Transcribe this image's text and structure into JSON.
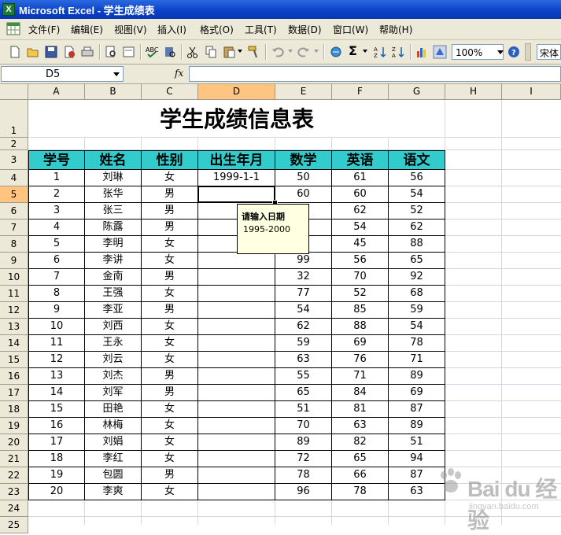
{
  "window": {
    "title": "Microsoft Excel - 学生成绩表",
    "app_icon_letter": "X"
  },
  "menu": [
    {
      "label": "文件(F)"
    },
    {
      "label": "编辑(E)"
    },
    {
      "label": "视图(V)"
    },
    {
      "label": "插入(I)"
    },
    {
      "label": "格式(O)"
    },
    {
      "label": "工具(T)"
    },
    {
      "label": "数据(D)"
    },
    {
      "label": "窗口(W)"
    },
    {
      "label": "帮助(H)"
    }
  ],
  "toolbar": {
    "zoom": "100%",
    "font": "宋体",
    "sigma": "Σ"
  },
  "formula_bar": {
    "name_box": "D5",
    "fx_label": "fx",
    "content": ""
  },
  "columns": [
    "A",
    "B",
    "C",
    "D",
    "E",
    "F",
    "G",
    "H",
    "I"
  ],
  "selected_column": "D",
  "rows": [
    "1",
    "2",
    "3",
    "4",
    "5",
    "6",
    "7",
    "8",
    "9",
    "10",
    "11",
    "12",
    "13",
    "14",
    "15",
    "16",
    "17",
    "18",
    "19",
    "20",
    "21",
    "22",
    "23",
    "24",
    "25"
  ],
  "selected_row": "5",
  "sheet": {
    "title": "学生成绩信息表",
    "headers": [
      "学号",
      "姓名",
      "性别",
      "出生年月",
      "数学",
      "英语",
      "语文"
    ],
    "records": [
      [
        "1",
        "刘琳",
        "女",
        "1999-1-1",
        "50",
        "61",
        "56"
      ],
      [
        "2",
        "张华",
        "男",
        "",
        "60",
        "60",
        "54"
      ],
      [
        "3",
        "张三",
        "男",
        "",
        "",
        "62",
        "52"
      ],
      [
        "4",
        "陈露",
        "男",
        "",
        "",
        "54",
        "62"
      ],
      [
        "5",
        "李明",
        "女",
        "",
        "",
        "45",
        "88"
      ],
      [
        "6",
        "李讲",
        "女",
        "",
        "99",
        "56",
        "65"
      ],
      [
        "7",
        "金南",
        "男",
        "",
        "32",
        "70",
        "92"
      ],
      [
        "8",
        "王强",
        "女",
        "",
        "77",
        "52",
        "68"
      ],
      [
        "9",
        "李亚",
        "男",
        "",
        "54",
        "85",
        "59"
      ],
      [
        "10",
        "刘西",
        "女",
        "",
        "62",
        "88",
        "54"
      ],
      [
        "11",
        "王永",
        "女",
        "",
        "59",
        "69",
        "78"
      ],
      [
        "12",
        "刘云",
        "女",
        "",
        "63",
        "76",
        "71"
      ],
      [
        "13",
        "刘杰",
        "男",
        "",
        "55",
        "71",
        "89"
      ],
      [
        "14",
        "刘军",
        "男",
        "",
        "65",
        "84",
        "69"
      ],
      [
        "15",
        "田艳",
        "女",
        "",
        "51",
        "81",
        "87"
      ],
      [
        "16",
        "林梅",
        "女",
        "",
        "70",
        "63",
        "89"
      ],
      [
        "17",
        "刘娟",
        "女",
        "",
        "89",
        "82",
        "51"
      ],
      [
        "18",
        "李红",
        "女",
        "",
        "72",
        "65",
        "94"
      ],
      [
        "19",
        "包圆",
        "男",
        "",
        "78",
        "66",
        "87"
      ],
      [
        "20",
        "李爽",
        "女",
        "",
        "96",
        "78",
        "63"
      ]
    ]
  },
  "tooltip": {
    "title": "请输入日期",
    "body": "1995-2000"
  },
  "watermark": {
    "text": "Bai du 经验",
    "url": "jingyan.baidu.com"
  },
  "colors": {
    "header_fill": "#33cccc",
    "selected_header": "#ffc580",
    "titlebar": "#0a40c8"
  }
}
